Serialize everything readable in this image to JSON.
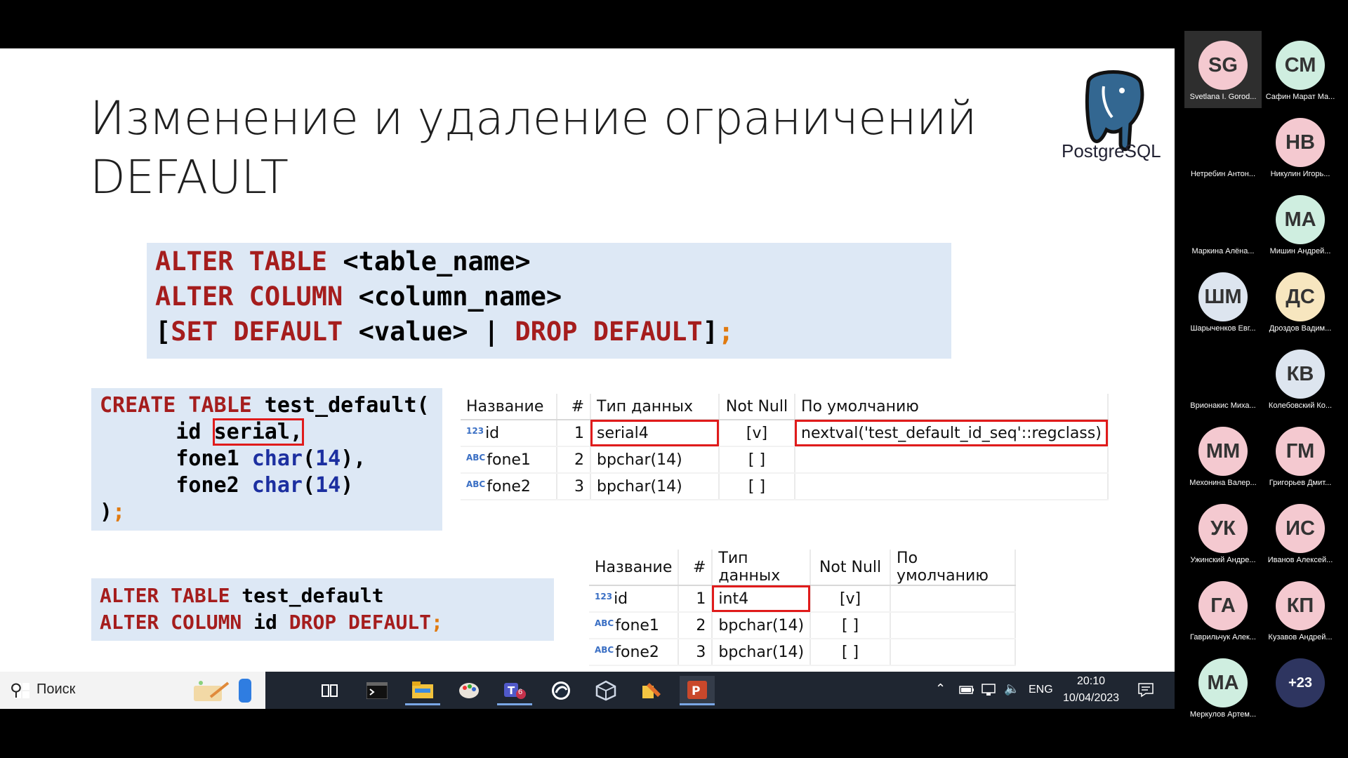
{
  "slide": {
    "title_line1": "Изменение и удаление ограничений",
    "title_line2": "DEFAULT",
    "logo_text": "PostgreSQL",
    "syntax": {
      "l1_kw1": "ALTER TABLE",
      "l1_rest": " <table_name>",
      "l2_kw1": "ALTER COLUMN",
      "l2_rest": " <column_name>",
      "l3_bracket": "[",
      "l3_kw1": "SET DEFAULT",
      "l3_mid": " <value> | ",
      "l3_kw2": "DROP DEFAULT",
      "l3_close": "]",
      "l3_semi": ";"
    },
    "create_code": {
      "l1_kw": "CREATE TABLE",
      "l1_rest": " test_default(",
      "l2_pre": "      id ",
      "l2_hl": "serial,",
      "l3_pre": "      fone1 ",
      "l3_type": "char",
      "l3_p1": "(",
      "l3_num": "14",
      "l3_p2": "),",
      "l4_pre": "      fone2 ",
      "l4_type": "char",
      "l4_p1": "(",
      "l4_num": "14",
      "l4_p2": ")",
      "l5": ")",
      "l5_semi": ";"
    },
    "alter_code": {
      "l1_kw": "ALTER TABLE",
      "l1_rest": " test_default",
      "l2_kw1": "ALTER COLUMN",
      "l2_mid": " id ",
      "l2_kw2": "DROP DEFAULT",
      "l2_semi": ";"
    },
    "table1": {
      "headers": [
        "Название",
        "#",
        "Тип данных",
        "Not Null",
        "По умолчанию"
      ],
      "rows": [
        {
          "icon": "123",
          "name": "id",
          "num": "1",
          "type": "serial4",
          "notnull": "[v]",
          "default": "nextval('test_default_id_seq'::regclass)"
        },
        {
          "icon": "ABC",
          "name": "fone1",
          "num": "2",
          "type": "bpchar(14)",
          "notnull": "[ ]",
          "default": ""
        },
        {
          "icon": "ABC",
          "name": "fone2",
          "num": "3",
          "type": "bpchar(14)",
          "notnull": "[ ]",
          "default": ""
        }
      ]
    },
    "table2": {
      "headers": [
        "Название",
        "#",
        "Тип данных",
        "Not Null",
        "По умолчанию"
      ],
      "rows": [
        {
          "icon": "123",
          "name": "id",
          "num": "1",
          "type": "int4",
          "notnull": "[v]",
          "default": ""
        },
        {
          "icon": "ABC",
          "name": "fone1",
          "num": "2",
          "type": "bpchar(14)",
          "notnull": "[ ]",
          "default": ""
        },
        {
          "icon": "ABC",
          "name": "fone2",
          "num": "3",
          "type": "bpchar(14)",
          "notnull": "[ ]",
          "default": ""
        }
      ]
    }
  },
  "taskbar": {
    "search_placeholder": "Поиск",
    "language": "ENG",
    "time": "20:10",
    "date": "10/04/2023",
    "apps": [
      "task-view-icon",
      "terminal-icon",
      "file-explorer-icon",
      "paint-icon",
      "teams-icon",
      "browser-icon",
      "virtualbox-icon",
      "tools-icon",
      "powerpoint-icon"
    ],
    "teams_badge": "6"
  },
  "participants": [
    {
      "initials": "SG",
      "name": "Svetlana I. Gorod...",
      "color": "#f4c9d0"
    },
    {
      "initials": "СМ",
      "name": "Сафин Марат Ма...",
      "color": "#cfeee0"
    },
    {
      "initials": "",
      "name": "Нетребин Антон...",
      "color": "#8a5a4a"
    },
    {
      "initials": "НВ",
      "name": "Никулин Игорь...",
      "color": "#f4c9d0"
    },
    {
      "initials": "",
      "name": "Маркина Алёна...",
      "color": "#d9c2b3"
    },
    {
      "initials": "МА",
      "name": "Мишин Андрей...",
      "color": "#cfeee0"
    },
    {
      "initials": "ШМ",
      "name": "Шарыченков Евг...",
      "color": "#dde5ef"
    },
    {
      "initials": "ДС",
      "name": "Дроздов Вадим...",
      "color": "#f7e6bf"
    },
    {
      "initials": "",
      "name": "Врионакис Миха...",
      "color": "#3a3a3a"
    },
    {
      "initials": "КВ",
      "name": "Колебовский Ко...",
      "color": "#dde5ef"
    },
    {
      "initials": "ММ",
      "name": "Мехонина Валер...",
      "color": "#f4c9d0"
    },
    {
      "initials": "ГМ",
      "name": "Григорьев Дмит...",
      "color": "#f4c9d0"
    },
    {
      "initials": "УК",
      "name": "Ужинский Андре...",
      "color": "#f4c9d0"
    },
    {
      "initials": "ИС",
      "name": "Иванов Алексей...",
      "color": "#f4c9d0"
    },
    {
      "initials": "ГА",
      "name": "Гаврильчук Алек...",
      "color": "#f4c9d0"
    },
    {
      "initials": "КП",
      "name": "Кузавов Андрей...",
      "color": "#f4c9d0"
    },
    {
      "initials": "МА",
      "name": "Меркулов Артем...",
      "color": "#cfeee0"
    },
    {
      "initials": "+23",
      "name": "",
      "color": "#2e3560"
    }
  ]
}
